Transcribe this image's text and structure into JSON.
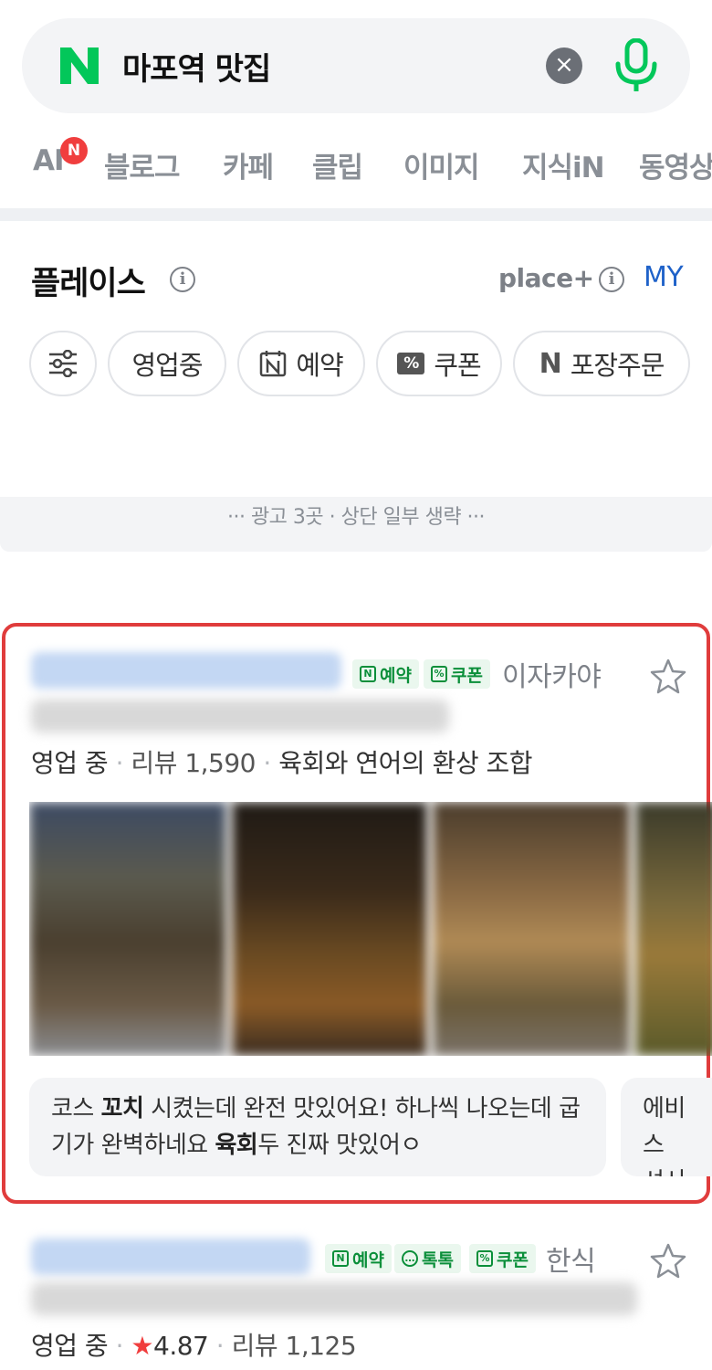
{
  "search": {
    "query": "마포역 맛집",
    "clear_symbol": "×"
  },
  "tabs": {
    "items": [
      "AI",
      "블로그",
      "카페",
      "클립",
      "이미지",
      "지식iN",
      "동영상"
    ],
    "ai_badge": "N"
  },
  "places": {
    "title": "플레이스",
    "info_symbol": "i",
    "place_plus": "place+",
    "my": "MY"
  },
  "filters": {
    "chips": [
      "영업중",
      "예약",
      "쿠폰",
      "포장주문"
    ],
    "reserve_icon": "N",
    "coupon_icon": "%",
    "takeout_icon": "N"
  },
  "ad_note": "··· 광고 3곳 · 상단 일부 생략 ···",
  "listing1": {
    "tags": [
      "예약",
      "쿠폰"
    ],
    "tag_icons": [
      "N",
      "%"
    ],
    "category": "이자카야",
    "status": "영업 중",
    "separator": "·",
    "reviews": "리뷰 1,590",
    "tagline": "육회와 연어의 환상 조합",
    "review_snippet": {
      "part1": "코스 ",
      "bold1": "꼬치",
      "part2": " 시켰는데 완전 맛있어요! 하나씩 나오는데 굽기가 완벽하네요 ",
      "bold2": "육회",
      "part3": "두 진짜 맛있어ㅇ"
    },
    "review_snippet_2": "에비스 셔서 맛"
  },
  "listing2": {
    "tags": [
      "예약",
      "톡톡",
      "쿠폰"
    ],
    "tag_icons": [
      "N",
      "…",
      "%"
    ],
    "category": "한식",
    "status": "영업 중",
    "separator": "·",
    "rating_star": "★",
    "rating": "4.87",
    "reviews": "리뷰 1,125"
  },
  "colors": {
    "brand_green": "#03c75a",
    "highlight_border": "#e03c3c",
    "tag_green": "#0b8f3a",
    "link_blue": "#1f62c9"
  },
  "icons": [
    "naver-logo-icon",
    "clear-icon",
    "mic-icon",
    "info-icon",
    "filter-sliders-icon",
    "calendar-icon",
    "coupon-icon",
    "star-outline-icon",
    "star-filled-icon"
  ]
}
